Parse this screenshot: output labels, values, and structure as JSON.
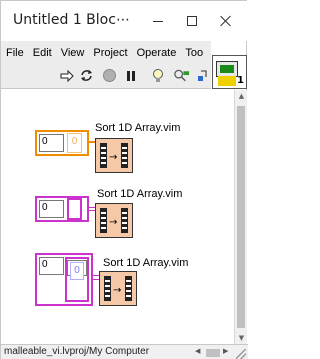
{
  "window": {
    "title": "Untitled 1 Bloc⋯"
  },
  "menu": {
    "items": [
      "File",
      "Edit",
      "View",
      "Project",
      "Operate",
      "Too"
    ]
  },
  "toolbar": {
    "tools": [
      {
        "name": "run-arrow-icon",
        "glyph": "⇨"
      },
      {
        "name": "run-continuously-icon",
        "glyph": "⟳"
      },
      {
        "name": "abort-icon",
        "glyph": "⏺"
      },
      {
        "name": "pause-icon",
        "glyph": "❚❚"
      },
      {
        "name": "highlight-execution-icon",
        "glyph": "💡"
      },
      {
        "name": "retain-wire-values-icon",
        "glyph": "⚙"
      },
      {
        "name": "step-into-icon",
        "glyph": "↳"
      }
    ],
    "vi_icon_number": "1"
  },
  "diagram": {
    "nodes": [
      {
        "label": "Sort 1D Array.vim",
        "index_value": "0",
        "element_value": "0",
        "color": "#f08c00"
      },
      {
        "label": "Sort 1D Array.vim",
        "index_value": "0",
        "element_value": "",
        "color": "#cc33cc"
      },
      {
        "label": "Sort 1D Array.vim",
        "index_value": "0",
        "index2_value": "0",
        "element_value": "0",
        "color": "#cc33cc"
      }
    ]
  },
  "status": {
    "text": "malleable_vi.lvproj/My Computer"
  }
}
